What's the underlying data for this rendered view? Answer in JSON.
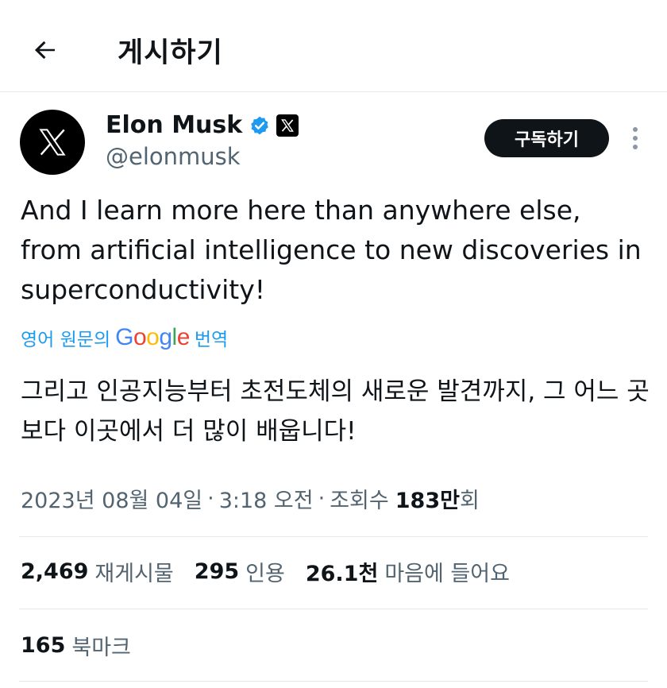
{
  "header": {
    "title": "게시하기"
  },
  "author": {
    "name": "Elon Musk",
    "handle": "@elonmusk"
  },
  "actions": {
    "subscribe_label": "구독하기"
  },
  "tweet": {
    "text": "And I learn more here than anywhere else, from artificial intelligence to new discoveries in superconductivity!",
    "translation_prefix": "영어 원문의",
    "translation_suffix": "번역",
    "translated_text": "그리고 인공지능부터 초전도체의 새로운 발견까지, 그 어느 곳보다 이곳에서 더 많이 배웁니다!"
  },
  "google_logo": {
    "text": "Google",
    "letters": [
      {
        "ch": "G",
        "color": "#4285F4"
      },
      {
        "ch": "o",
        "color": "#EA4335"
      },
      {
        "ch": "o",
        "color": "#FBBC05"
      },
      {
        "ch": "g",
        "color": "#4285F4"
      },
      {
        "ch": "l",
        "color": "#34A853"
      },
      {
        "ch": "e",
        "color": "#EA4335"
      }
    ]
  },
  "meta": {
    "date": "2023년 08월 04일",
    "time": "3:18 오전",
    "views_label": "조회수",
    "views_count": "183만",
    "views_suffix": "회",
    "separator": "·"
  },
  "stats": {
    "reposts_count": "2,469",
    "reposts_label": "재게시물",
    "quotes_count": "295",
    "quotes_label": "인용",
    "likes_count": "26.1천",
    "likes_label": "마음에 들어요",
    "bookmarks_count": "165",
    "bookmarks_label": "북마크"
  },
  "icons": {
    "back": "arrow-left-icon",
    "avatar": "x-logo-icon",
    "verified": "verified-badge-icon",
    "affiliation": "x-affiliation-icon",
    "more": "more-vertical-icon"
  },
  "colors": {
    "accent": "#1d9bf0",
    "text": "#0f1419",
    "secondary": "#536471",
    "divider": "#e5e9ec"
  }
}
